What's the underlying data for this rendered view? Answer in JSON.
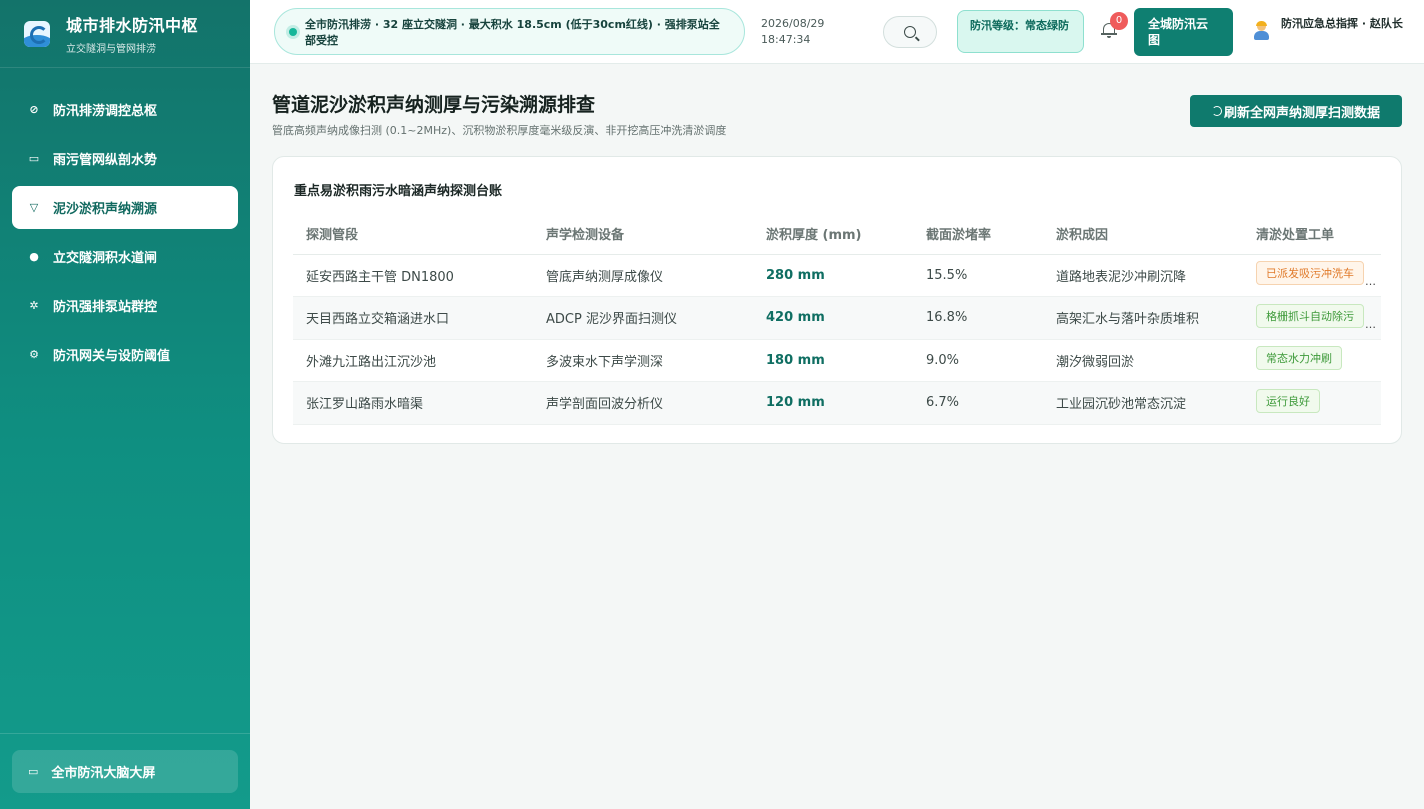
{
  "brand": {
    "title": "城市排水防汛中枢",
    "subtitle": "立交隧洞与管网排涝"
  },
  "nav": {
    "items": [
      {
        "label": "防汛排涝调控总枢",
        "icon": "compass-icon",
        "glyph": "⊘"
      },
      {
        "label": "雨污管网纵剖水势",
        "icon": "monitor-icon",
        "glyph": "▭"
      },
      {
        "label": "泥沙淤积声纳溯源",
        "icon": "filter-icon",
        "glyph": "▽",
        "active": true
      },
      {
        "label": "立交隧洞积水道闸",
        "icon": "alert-circle-icon",
        "glyph": "●"
      },
      {
        "label": "防汛强排泵站群控",
        "icon": "loader-icon",
        "glyph": "✲"
      },
      {
        "label": "防汛网关与设防阈值",
        "icon": "gear-icon",
        "glyph": "⚙"
      }
    ],
    "footer_label": "全市防汛大脑大屏",
    "footer_icon": "screen-icon"
  },
  "topbar": {
    "ticker": "全市防汛排涝 · 32 座立交隧洞 · 最大积水 18.5cm (低于30cm红线) · 强排泵站全部受控",
    "date": "2026/08/29",
    "time": "18:47:34",
    "level": "防汛等级：常态绿防",
    "notifications": "0",
    "cloud_button": "全城防汛云图",
    "user": "防汛应急总指挥 · 赵队长"
  },
  "page": {
    "title": "管道泥沙淤积声纳测厚与污染溯源排查",
    "subtitle": "管底高频声纳成像扫测 (0.1~2MHz)、沉积物淤积厚度毫米级反演、非开挖高压冲洗清淤调度",
    "refresh_button": "刷新全网声纳测厚扫测数据"
  },
  "ledger": {
    "title": "重点易淤积雨污水暗涵声纳探测台账",
    "columns": [
      "探测管段",
      "声学检测设备",
      "淤积厚度 (mm)",
      "截面淤堵率",
      "淤积成因",
      "清淤处置工单"
    ],
    "rows": [
      {
        "segment": "延安西路主干管 DN1800",
        "device": "管底声纳测厚成像仪",
        "thickness": "280 mm",
        "blockage": "15.5%",
        "cause": "道路地表泥沙冲刷沉降",
        "order": "已派发吸污冲洗车",
        "order_style": "orange",
        "truncated": true
      },
      {
        "segment": "天目西路立交箱涵进水口",
        "device": "ADCP 泥沙界面扫测仪",
        "thickness": "420 mm",
        "blockage": "16.8%",
        "cause": "高架汇水与落叶杂质堆积",
        "order": "格栅抓斗自动除污",
        "order_style": "green",
        "truncated": true
      },
      {
        "segment": "外滩九江路出江沉沙池",
        "device": "多波束水下声学测深",
        "thickness": "180 mm",
        "blockage": "9.0%",
        "cause": "潮汐微弱回淤",
        "order": "常态水力冲刷",
        "order_style": "green",
        "truncated": false
      },
      {
        "segment": "张江罗山路雨水暗渠",
        "device": "声学剖面回波分析仪",
        "thickness": "120 mm",
        "blockage": "6.7%",
        "cause": "工业园沉砂池常态沉淀",
        "order": "运行良好",
        "order_style": "green",
        "truncated": false
      }
    ]
  },
  "colors": {
    "primary": "#0f7a6d",
    "accent": "#16b79a",
    "warning": "#e07a2a",
    "ok": "#3e9a3a",
    "alert": "#ef5b5b"
  }
}
